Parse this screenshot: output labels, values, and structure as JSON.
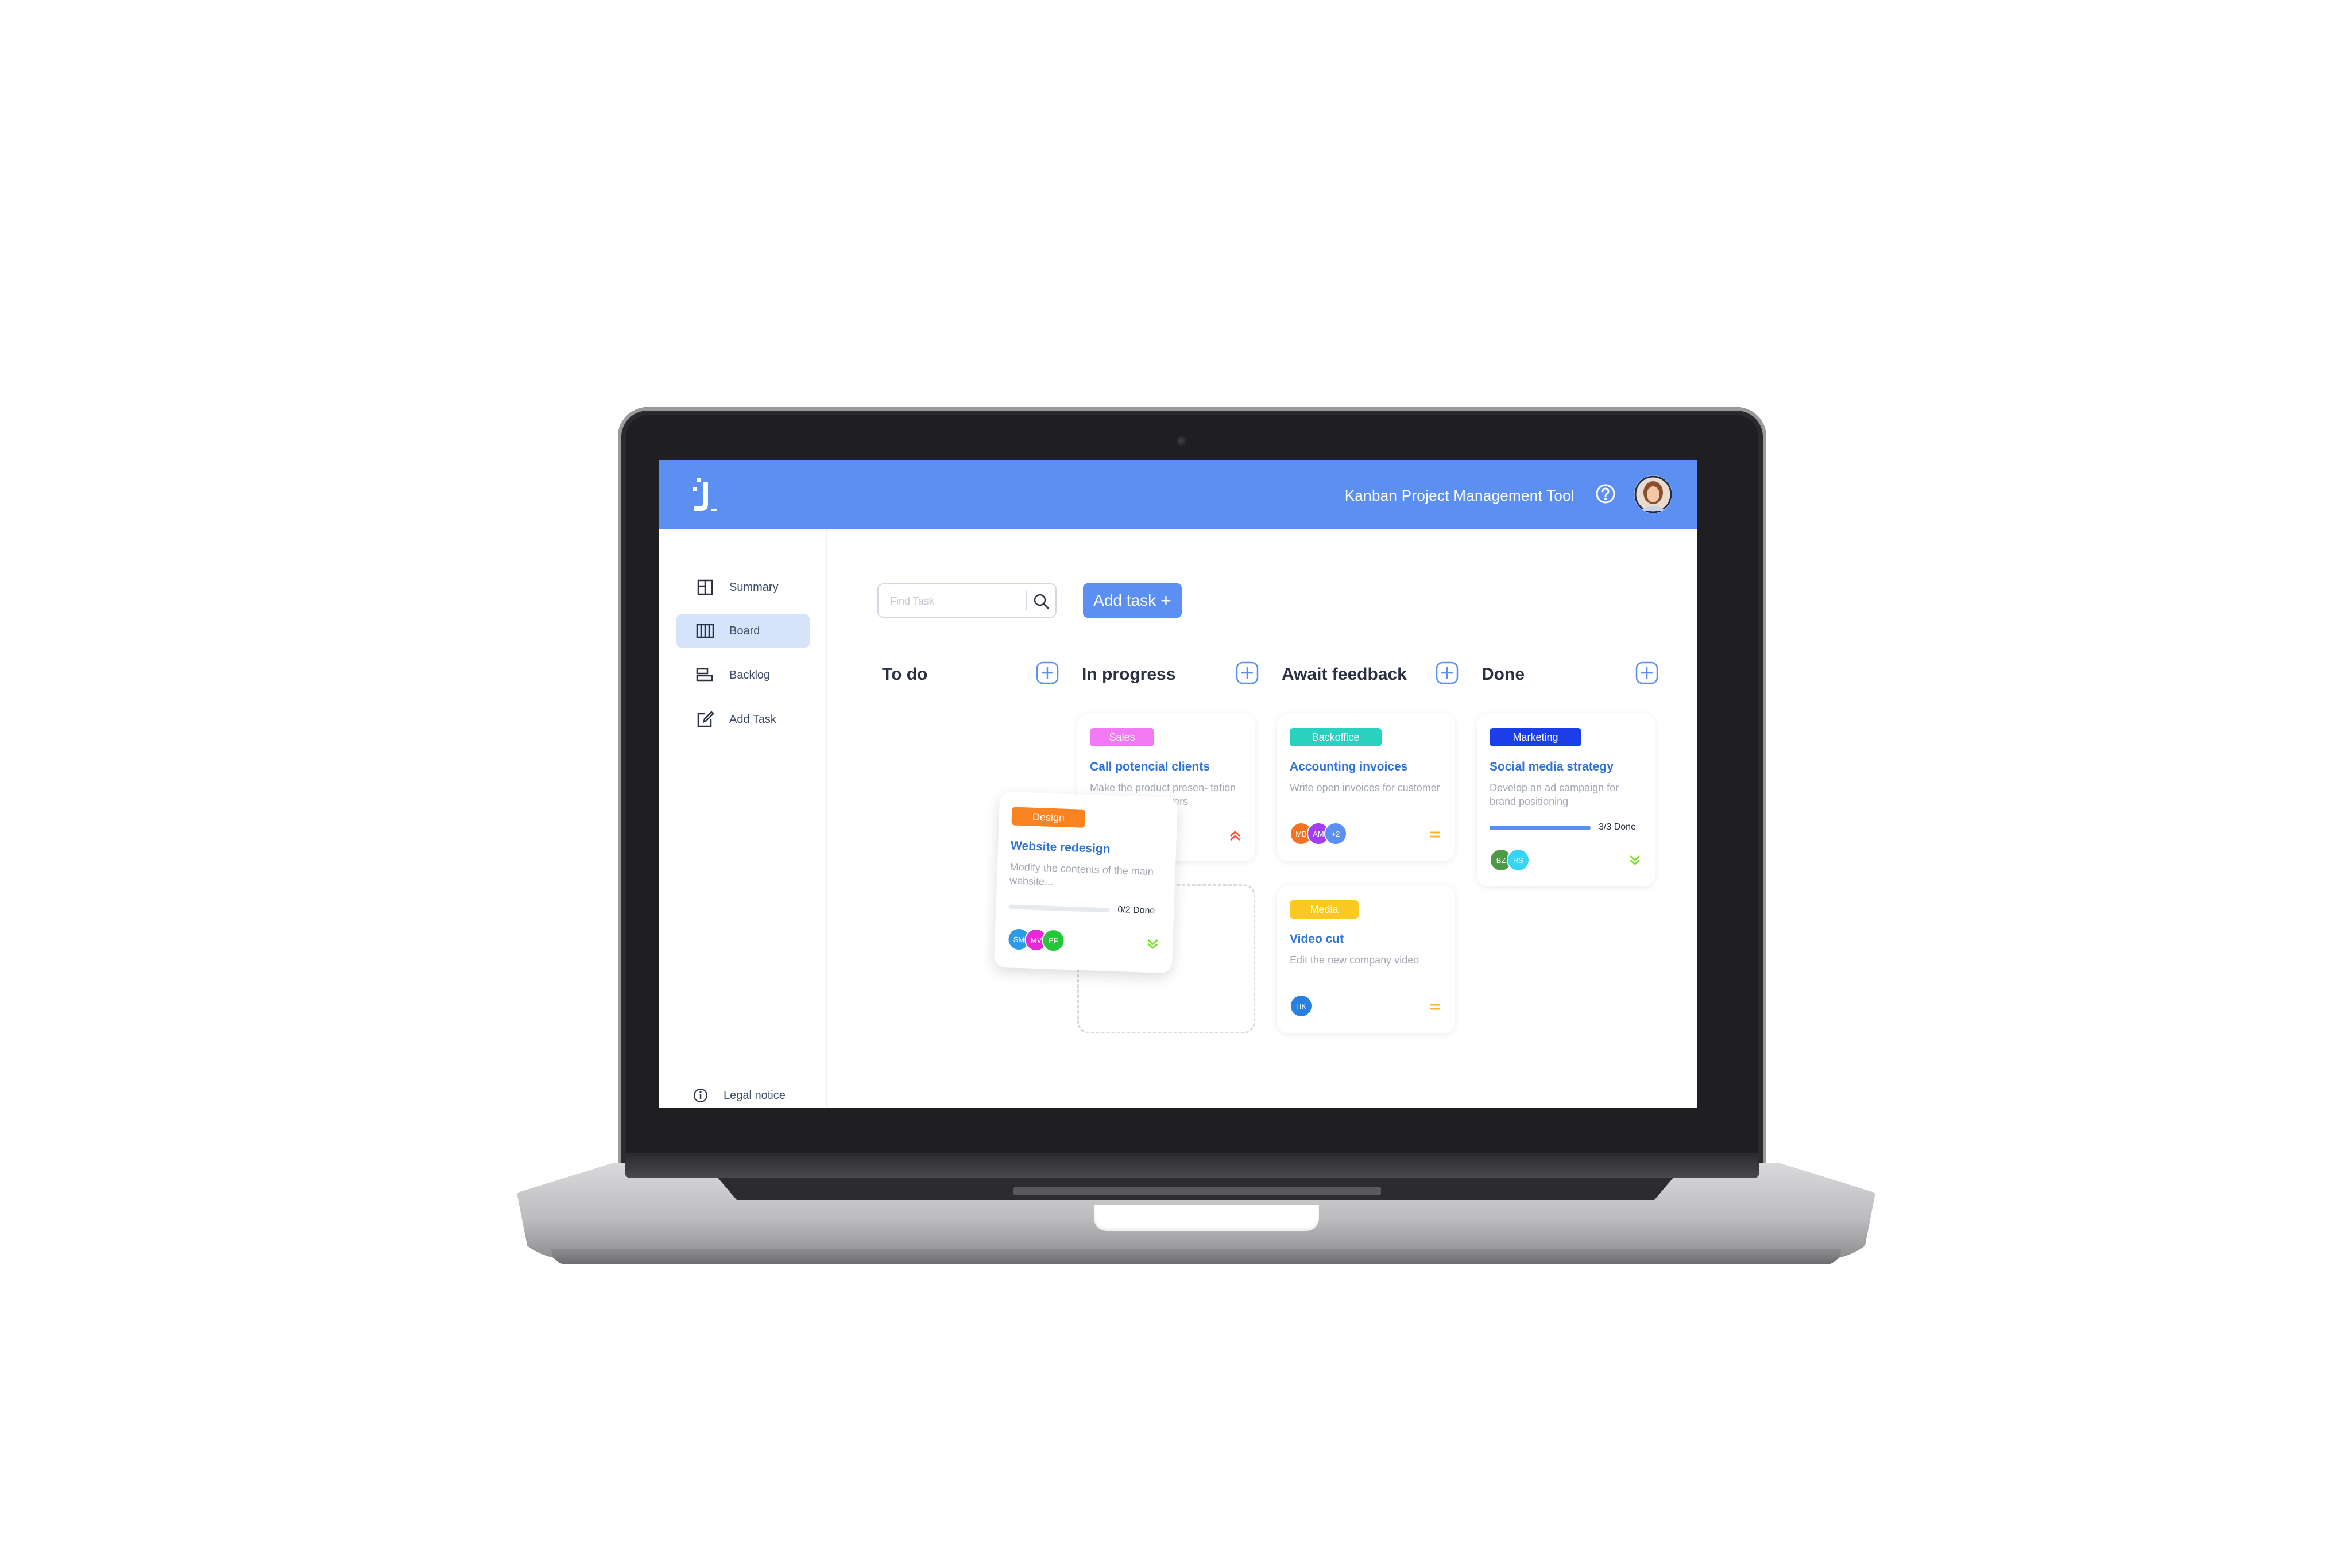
{
  "header": {
    "app_title": "Kanban Project Management Tool",
    "logo_icon": "join-logo-icon",
    "help_icon": "help-icon",
    "avatar": "user-avatar",
    "color": "#5b8ff2"
  },
  "sidebar": {
    "items": [
      {
        "label": "Summary",
        "icon": "summary-icon"
      },
      {
        "label": "Board",
        "icon": "board-icon",
        "active": true
      },
      {
        "label": "Backlog",
        "icon": "backlog-icon"
      },
      {
        "label": "Add Task",
        "icon": "add-task-icon"
      }
    ],
    "legal_notice": "Legal notice"
  },
  "toolbar": {
    "search_placeholder": "Find Task",
    "add_task_label": "Add task",
    "add_task_plus": "+"
  },
  "columns": [
    {
      "title": "To do"
    },
    {
      "title": "In progress"
    },
    {
      "title": "Await feedback"
    },
    {
      "title": "Done"
    }
  ],
  "cards": {
    "call_clients": {
      "tag": "Sales",
      "tag_color": "#f27af5",
      "title": "Call potencial clients",
      "desc": "Make the product presen- tation to prospective buyers",
      "priority": "urgent"
    },
    "accounting": {
      "tag": "Backoffice",
      "tag_color": "#2ad0c0",
      "title": "Accounting invoices",
      "desc": "Write open invoices for customer",
      "avatars": [
        {
          "initials": "MB",
          "color": "#f57222"
        },
        {
          "initials": "AM",
          "color": "#a23ff0"
        },
        {
          "initials": "+2",
          "color": "#5b8ff2"
        }
      ],
      "priority": "medium"
    },
    "social_media": {
      "tag": "Marketing",
      "tag_color": "#1c3ee8",
      "title": "Social media strategy",
      "desc": "Develop an ad campaign for brand positioning",
      "progress": 1.0,
      "progress_label": "3/3 Done",
      "avatars": [
        {
          "initials": "BZ",
          "color": "#4c9a45"
        },
        {
          "initials": "RS",
          "color": "#37d5f5"
        }
      ],
      "priority": "low"
    },
    "video_cut": {
      "tag": "Media",
      "tag_color": "#fcc822",
      "title": "Video cut",
      "desc": "Edit the new company video",
      "avatars": [
        {
          "initials": "HK",
          "color": "#2781e0"
        }
      ],
      "priority": "medium"
    },
    "website_redesign": {
      "tag": "Design",
      "tag_color": "#f98221",
      "title": "Website redesign",
      "desc": "Modify the contents of the main website...",
      "progress": 0.0,
      "progress_label": "0/2 Done",
      "avatars": [
        {
          "initials": "SM",
          "color": "#2a9be8"
        },
        {
          "initials": "MV",
          "color": "#e62ad7"
        },
        {
          "initials": "EF",
          "color": "#22c83a"
        }
      ],
      "priority": "low"
    }
  },
  "colors": {
    "urgent": "#f0573a",
    "medium": "#fdb534",
    "low": "#7ae229"
  }
}
